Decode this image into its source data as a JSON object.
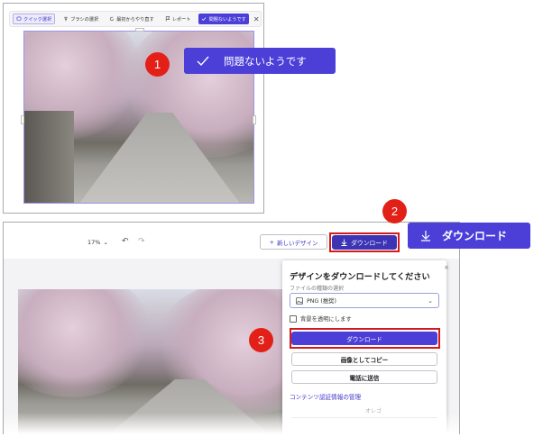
{
  "quick_toolbar": {
    "items": [
      {
        "label": "クイック選択",
        "icon": "lasso-icon",
        "selected": true
      },
      {
        "label": "ブラシの選択",
        "icon": "brush-icon",
        "selected": false
      },
      {
        "label": "最初からやり直す",
        "icon": "restart-icon",
        "selected": false
      },
      {
        "label": "レポート",
        "icon": "flag-icon",
        "selected": false
      }
    ],
    "ok_label": "問題ないようです",
    "close_glyph": "✕"
  },
  "callouts": {
    "one": {
      "number": "1",
      "label": "問題ないようです"
    },
    "two": {
      "number": "2",
      "label": "ダウンロード"
    },
    "three": {
      "number": "3"
    }
  },
  "editor": {
    "zoom": "17%",
    "new_design_label": "新しいデザイン",
    "download_label": "ダウンロード"
  },
  "download_panel": {
    "title": "デザインをダウンロードしてください",
    "file_type_label": "ファイルの種類の選択",
    "file_type_value": "PNG (推奨)",
    "transparent_label": "背景を透明にします",
    "download_button": "ダウンロード",
    "copy_button": "画像としてコピー",
    "email_button": "電話に送信",
    "credentials_link": "コンテンツ認証情報の管理",
    "faded_text": "オレゴ",
    "close_glyph": "×"
  },
  "colors": {
    "accent": "#4b3fd8",
    "badge_red": "#e32018",
    "highlight_red": "#d41a1a"
  }
}
